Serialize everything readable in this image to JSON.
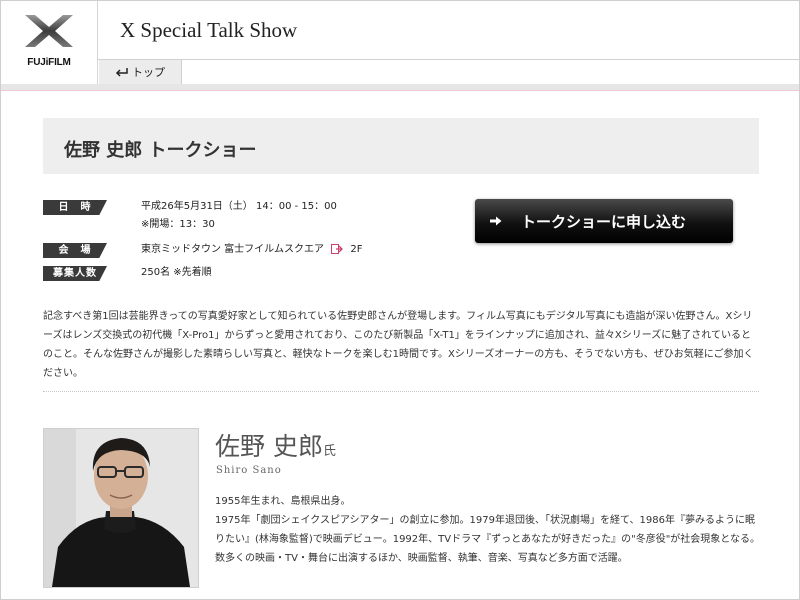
{
  "brand": {
    "name": "FUJiFILM"
  },
  "header": {
    "title": "X Special Talk Show"
  },
  "nav": {
    "top_label": "トップ"
  },
  "event": {
    "title": "佐野 史郎 トークショー",
    "info": [
      {
        "label": "日　時",
        "lines": [
          "平成26年5月31日（土） 14：00 - 15：00",
          "※開場：13：30"
        ]
      },
      {
        "label": "会　場",
        "venue": "東京ミッドタウン 富士フイルムスクエア",
        "floor": "2F"
      },
      {
        "label": "募集人数",
        "lines": [
          "250名 ※先着順"
        ]
      }
    ],
    "apply_label": "トークショーに申し込む",
    "description": "記念すべき第1回は芸能界きっての写真愛好家として知られている佐野史郎さんが登場します。フィルム写真にもデジタル写真にも造詣が深い佐野さん。Xシリーズはレンズ交換式の初代機「X-Pro1」からずっと愛用されており、このたび新製品「X-T1」をラインナップに追加され、益々Xシリーズに魅了されているとのこと。そんな佐野さんが撮影した素晴らしい写真と、軽快なトークを楽しむ1時間です。Xシリーズオーナーの方も、そうでない方も、ぜひお気軽にご参加ください。"
  },
  "profile": {
    "name": "佐野 史郎",
    "honorific": "氏",
    "romaji": "Shiro Sano",
    "bio": [
      "1955年生まれ、島根県出身。",
      "1975年「劇団シェイクスピアシアター」の創立に参加。1979年退団後、「状況劇場」を経て、1986年『夢みるように眠りたい』(林海象監督)で映画デビュー。1992年、TVドラマ『ずっとあなたが好きだった』の\"冬彦役\"が社会現象となる。数多くの映画・TV・舞台に出演するほか、映画監督、執筆、音楽、写真など多方面で活躍。"
    ]
  }
}
